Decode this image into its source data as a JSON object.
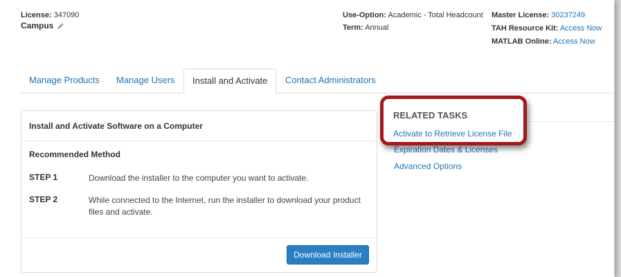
{
  "header": {
    "license_label": "License:",
    "license_value": "347090",
    "license_name": "Campus",
    "use_option_label": "Use-Option:",
    "use_option_value": "Academic - Total Headcount",
    "term_label": "Term:",
    "term_value": "Annual",
    "master_license_label": "Master License:",
    "master_license_value": "30237249",
    "tah_kit_label": "TAH Resource Kit:",
    "tah_kit_link": "Access Now",
    "matlab_online_label": "MATLAB Online:",
    "matlab_online_link": "Access Now"
  },
  "tabs": [
    {
      "label": "Manage Products"
    },
    {
      "label": "Manage Users"
    },
    {
      "label": "Install and Activate"
    },
    {
      "label": "Contact Administrators"
    }
  ],
  "card": {
    "title": "Install and Activate Software on a Computer",
    "subtitle": "Recommended Method",
    "steps": [
      {
        "label": "STEP 1",
        "text": "Download the installer to the computer you want to activate."
      },
      {
        "label": "STEP 2",
        "text": "While connected to the Internet, run the installer to download your product files and activate."
      }
    ],
    "button_label": "Download Installer"
  },
  "related": {
    "title": "RELATED TASKS",
    "links": [
      "Activate to Retrieve License File",
      "Advanced Options"
    ],
    "partial_hidden": "Expiration Dates & Licenses"
  },
  "colors": {
    "link": "#1a73b8",
    "button": "#2a7ec3",
    "callout_border": "#a31a1a"
  }
}
